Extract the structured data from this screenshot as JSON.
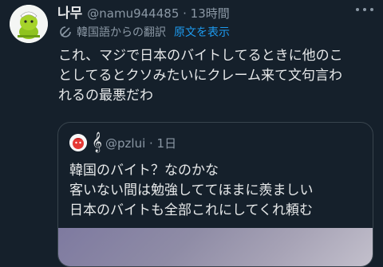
{
  "tweet": {
    "display_name": "나무",
    "handle_time": "@namu944485 · 13時間",
    "translate": {
      "label": "韓国語からの翻訳",
      "show_original": "原文を表示"
    },
    "lines": [
      "これ、マジで日本のバイトしてるときに他のこ",
      "としてるとクソみたいにクレーム来て文句言わ",
      "れるの最悪だわ"
    ]
  },
  "quote": {
    "handle_time": "@pzlui · 1日",
    "clef": "𝄞",
    "lines": [
      "韓国のバイト？なのかな",
      "客いない間は勉強しててほまに羨ましい",
      "日本のバイトも全部これにしてくれ頼む"
    ]
  },
  "icons": {
    "more": "more-horizontal-icon",
    "translate": "translate-icon"
  },
  "colors": {
    "background": "#15202b",
    "text": "#e7e9ea",
    "secondary": "#8b98a5",
    "link": "#1d9bf0",
    "border": "#38444d"
  }
}
